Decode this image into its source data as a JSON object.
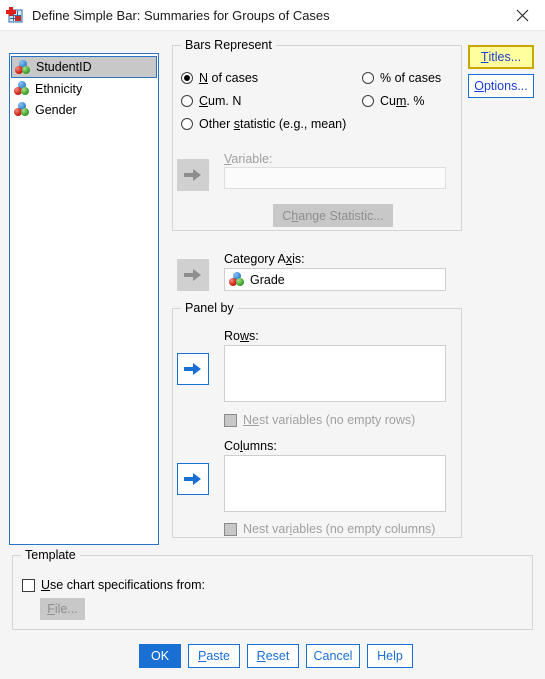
{
  "window": {
    "title": "Define Simple Bar: Summaries for Groups of Cases",
    "icon": "spss-bar-chart-icon",
    "close_icon": "close-icon"
  },
  "variable_list": {
    "name": "source-variable-list",
    "items": [
      {
        "label": "StudentID",
        "icon": "nominal-variable-icon",
        "selected": true
      },
      {
        "label": "Ethnicity",
        "icon": "nominal-variable-icon",
        "selected": false
      },
      {
        "label": "Gender",
        "icon": "nominal-variable-icon",
        "selected": false
      }
    ]
  },
  "bars_represent": {
    "legend": "Bars Represent",
    "options": [
      {
        "label_pre": "",
        "mnemonic": "N",
        "label_post": " of cases",
        "checked": true
      },
      {
        "label_pre": "",
        "mnemonic": "C",
        "label_post": "um. N",
        "checked": false
      },
      {
        "label_pre": "",
        "mnemonic": "%",
        "label_post": " of cases",
        "checked": false
      },
      {
        "label_pre": "Cu",
        "mnemonic": "m",
        "label_post": ". %",
        "checked": false
      },
      {
        "label_pre": "Other ",
        "mnemonic": "s",
        "label_post": "tatistic (e.g., mean)",
        "checked": false
      }
    ],
    "variable_label_pre": "",
    "variable_mnemonic": "V",
    "variable_label_post": "ariable:",
    "variable_value": "",
    "change_statistic_pre": "C",
    "change_statistic_mnemonic": "h",
    "change_statistic_post": "ange Statistic...",
    "move_icon": "arrow-right-icon"
  },
  "category_axis": {
    "label_pre": "Category A",
    "mnemonic": "x",
    "label_post": "is:",
    "value": "Grade",
    "value_icon": "nominal-variable-icon",
    "move_icon": "arrow-right-icon"
  },
  "panel_by": {
    "legend": "Panel by",
    "rows": {
      "label_pre": "Ro",
      "mnemonic": "w",
      "label_post": "s:",
      "value": "",
      "move_icon": "arrow-right-icon",
      "nest_pre": "N",
      "nest_mnemonic": "e",
      "nest_post": "st variables (no empty rows)",
      "nest_checked": false
    },
    "columns": {
      "label_pre": "Co",
      "mnemonic": "l",
      "label_post": "umns:",
      "value": "",
      "move_icon": "arrow-right-icon",
      "nest_pre": "Nest var",
      "nest_mnemonic": "i",
      "nest_post": "ables (no empty columns)",
      "nest_checked": false
    }
  },
  "template": {
    "legend": "Template",
    "checkbox_pre": "",
    "checkbox_mnemonic": "U",
    "checkbox_post": "se chart specifications from:",
    "checkbox_checked": false,
    "file_pre": "",
    "file_mnemonic": "F",
    "file_post": "ile..."
  },
  "side_buttons": [
    {
      "name": "titles-button",
      "pre": "",
      "mnemonic": "T",
      "post": "itles...",
      "state": "hover"
    },
    {
      "name": "options-button",
      "pre": "",
      "mnemonic": "O",
      "post": "ptions...",
      "state": "focus"
    }
  ],
  "footer_buttons": [
    {
      "name": "ok-button",
      "pre": "OK",
      "mnemonic": "",
      "post": "",
      "style": "primary"
    },
    {
      "name": "paste-button",
      "pre": "",
      "mnemonic": "P",
      "post": "aste",
      "style": "outline"
    },
    {
      "name": "reset-button",
      "pre": "",
      "mnemonic": "R",
      "post": "eset",
      "style": "outline"
    },
    {
      "name": "cancel-button",
      "pre": "Cancel",
      "mnemonic": "",
      "post": "",
      "style": "outline"
    },
    {
      "name": "help-button",
      "pre": "Help",
      "mnemonic": "",
      "post": "",
      "style": "outline"
    }
  ],
  "colors": {
    "accent": "#1a6fd4",
    "hover_highlight": "#ffff9e",
    "selection": "#c8c8c8",
    "dialog_bg": "#f5f5f5"
  }
}
